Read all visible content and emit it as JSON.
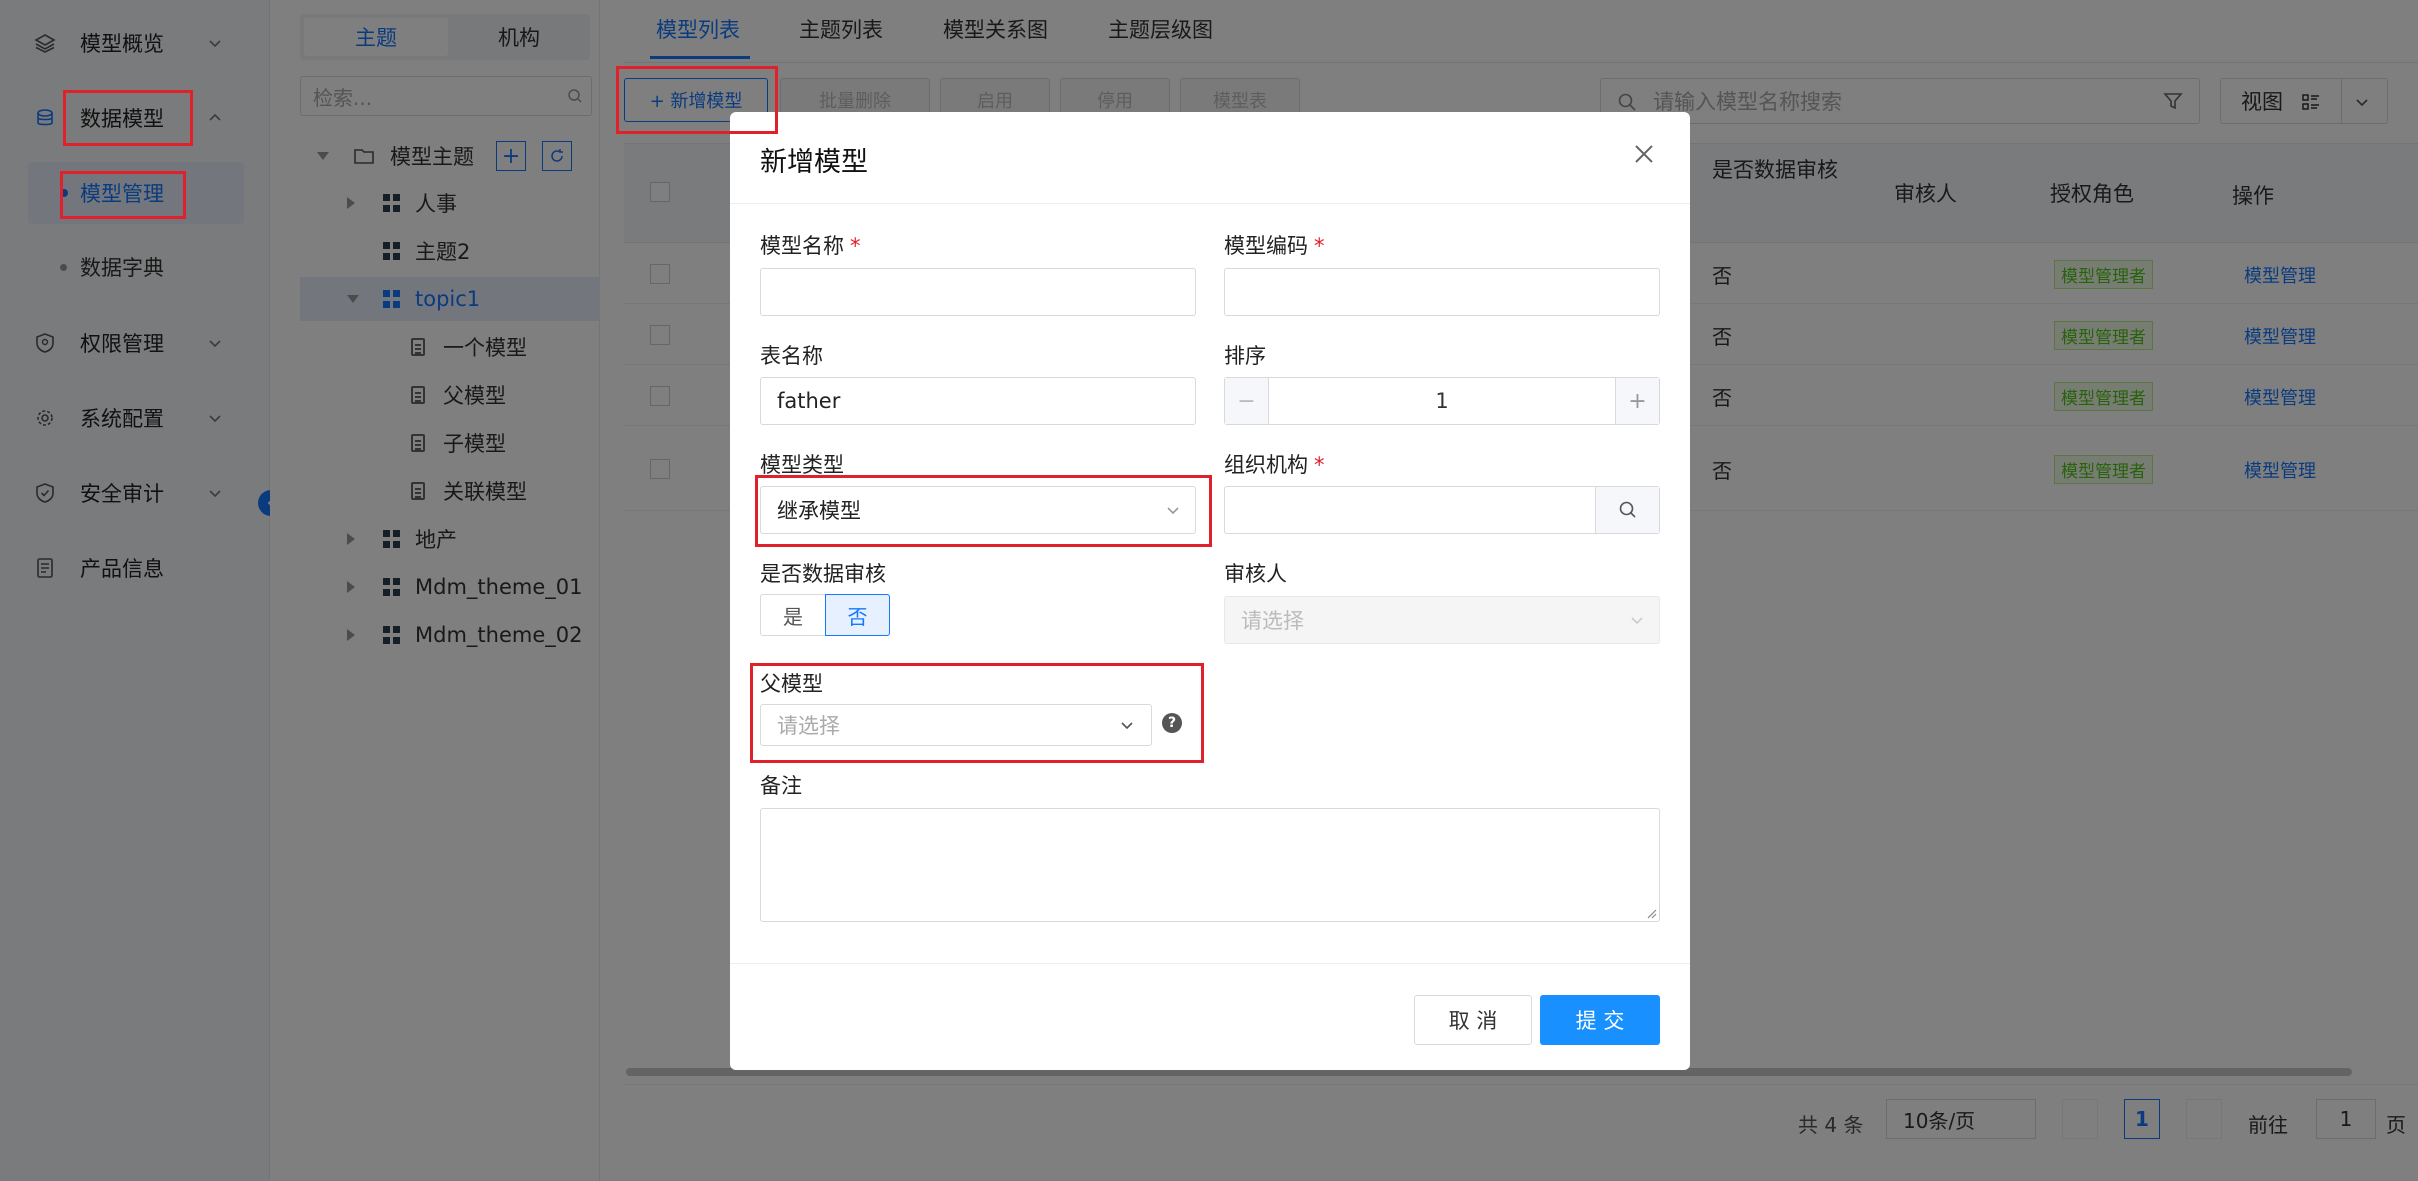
{
  "sidebar": {
    "items": [
      {
        "label": "模型概览",
        "icon": "layers-icon"
      },
      {
        "label": "数据模型",
        "icon": "database-icon"
      },
      {
        "label": "权限管理",
        "icon": "shield-icon"
      },
      {
        "label": "系统配置",
        "icon": "gear-icon"
      },
      {
        "label": "安全审计",
        "icon": "audit-shield-icon"
      },
      {
        "label": "产品信息",
        "icon": "document-icon"
      }
    ],
    "sub_items": [
      {
        "label": "模型管理"
      },
      {
        "label": "数据字典"
      }
    ]
  },
  "tree": {
    "segment_tabs": [
      "主题",
      "机构"
    ],
    "search_placeholder": "检索...",
    "root_label": "模型主题",
    "nodes": [
      {
        "label": "人事"
      },
      {
        "label": "主题2"
      },
      {
        "label": "topic1"
      },
      {
        "label": "一个模型"
      },
      {
        "label": "父模型"
      },
      {
        "label": "子模型"
      },
      {
        "label": "关联模型"
      },
      {
        "label": "地产"
      },
      {
        "label": "Mdm_theme_01"
      },
      {
        "label": "Mdm_theme_02"
      }
    ]
  },
  "main": {
    "tabs": [
      "模型列表",
      "主题列表",
      "模型关系图",
      "主题层级图"
    ],
    "toolbar": {
      "add": "+ 新增模型",
      "batch_delete": "批量删除",
      "enable": "启用",
      "disable": "停用",
      "model_table": "模型表"
    },
    "search_placeholder": "请输入模型名称搜索",
    "view_label": "视图",
    "table": {
      "headers": [
        "是否数据审核",
        "审核人",
        "授权角色",
        "操作"
      ],
      "rows": [
        {
          "audit": "否",
          "reviewer": "",
          "role": "模型管理者",
          "action": "模型管理"
        },
        {
          "audit": "否",
          "reviewer": "",
          "role": "模型管理者",
          "action": "模型管理"
        },
        {
          "audit": "否",
          "reviewer": "",
          "role": "模型管理者",
          "action": "模型管理"
        },
        {
          "audit": "否",
          "reviewer": "",
          "role": "模型管理者",
          "action": "模型管理"
        }
      ]
    },
    "pagination": {
      "total": "共 4 条",
      "page_size": "10条/页",
      "current": "1",
      "goto_label": "前往",
      "goto_value": "1",
      "page_suffix": "页"
    }
  },
  "modal": {
    "title": "新增模型",
    "fields": {
      "model_name": {
        "label": "模型名称",
        "value": ""
      },
      "model_code": {
        "label": "模型编码",
        "value": ""
      },
      "table_name": {
        "label": "表名称",
        "value": "father"
      },
      "sort": {
        "label": "排序",
        "value": "1"
      },
      "model_type": {
        "label": "模型类型",
        "value": "继承模型"
      },
      "org": {
        "label": "组织机构",
        "value": ""
      },
      "data_audit": {
        "label": "是否数据审核",
        "options": [
          "是",
          "否"
        ],
        "selected": "否"
      },
      "reviewer": {
        "label": "审核人",
        "placeholder": "请选择"
      },
      "parent_model": {
        "label": "父模型",
        "placeholder": "请选择"
      },
      "remark": {
        "label": "备注",
        "value": ""
      }
    },
    "cancel_label": "取 消",
    "submit_label": "提 交"
  },
  "colors": {
    "primary": "#1677ff",
    "highlight_red": "#e0202a",
    "tag_green": "#52c41a"
  }
}
